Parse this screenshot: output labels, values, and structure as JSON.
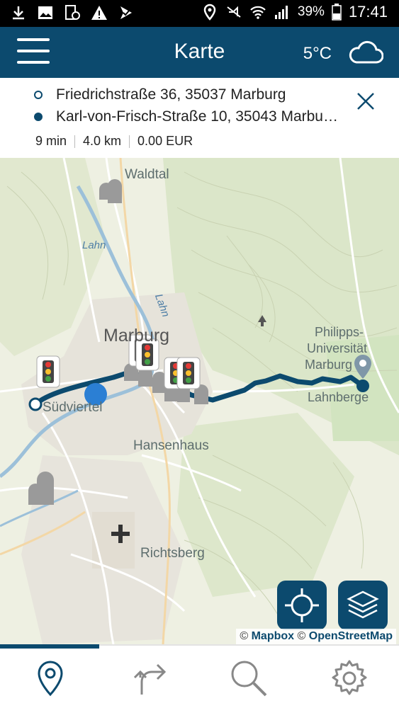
{
  "status_bar": {
    "battery_percent": "39%",
    "time": "17:41",
    "icons": [
      "download-icon",
      "image-icon",
      "screenshot-icon",
      "warning-icon",
      "check-icon",
      "location-icon",
      "mute-icon",
      "wifi-icon",
      "signal-icon",
      "battery-icon"
    ]
  },
  "app_bar": {
    "title": "Karte",
    "temperature": "5°C",
    "weather_icon": "cloud-icon"
  },
  "route": {
    "origin": "Friedrichstraße 36, 35037 Marburg",
    "destination": "Karl-von-Frisch-Straße 10, 35043 Marbu…",
    "duration": "9 min",
    "distance": "4.0 km",
    "cost": "0.00 EUR"
  },
  "map": {
    "labels": {
      "waldtal": "Waldtal",
      "lahn_1": "Lahn",
      "lahn_2": "Lahn",
      "marburg": "Marburg",
      "suedviertel": "Südviertel",
      "philipps_1": "Philipps-",
      "philipps_2": "Universität",
      "philipps_3": "Marburg",
      "lahnberge": "Lahnberge",
      "hansenhaus": "Hansenhaus",
      "richtsberg": "Richtsberg"
    },
    "attribution": {
      "prefix": "©",
      "mapbox": "Mapbox",
      "mid": "©",
      "osm": "OpenStreetMap"
    },
    "colors": {
      "route": "#0c4a6e",
      "current_location": "#2b7fd4",
      "land": "#eef0e2",
      "water": "#9cc0d9",
      "forest": "#d9e7c8"
    }
  },
  "tabs": [
    {
      "name": "map",
      "icon": "map-pin-icon",
      "active": true
    },
    {
      "name": "directions",
      "icon": "directions-icon",
      "active": false
    },
    {
      "name": "search",
      "icon": "search-icon",
      "active": false
    },
    {
      "name": "settings",
      "icon": "settings-icon",
      "active": false
    }
  ]
}
